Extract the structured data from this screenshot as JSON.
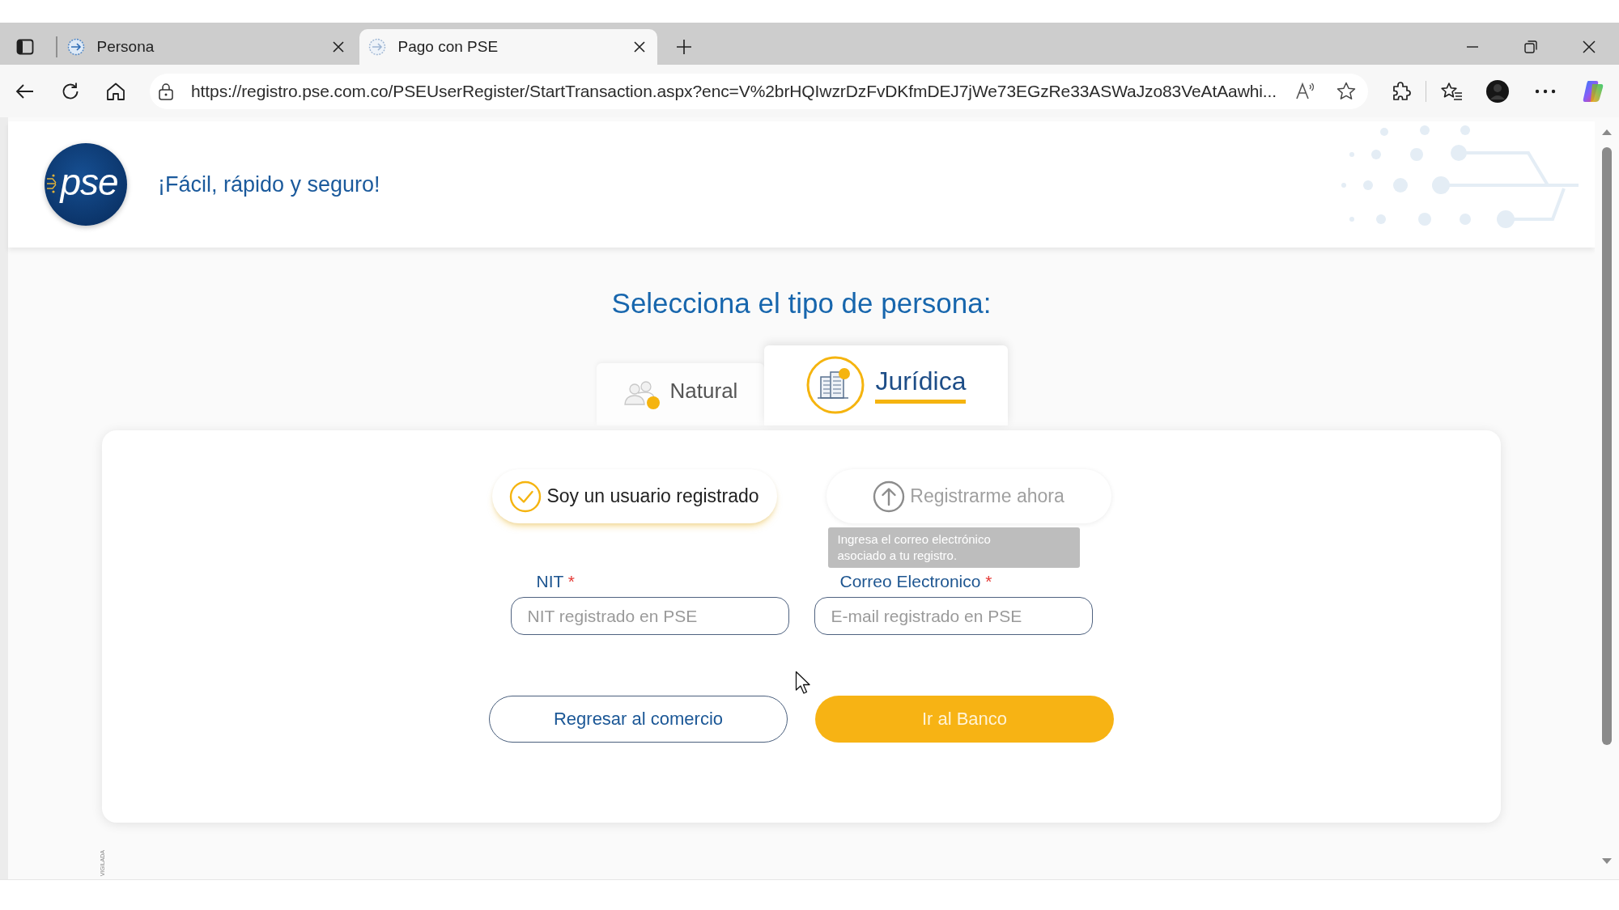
{
  "browser": {
    "tabs": [
      {
        "title": "Persona",
        "selected": false
      },
      {
        "title": "Pago con PSE",
        "selected": true
      }
    ],
    "address": "https://registro.pse.com.co/PSEUserRegister/StartTransaction.aspx?enc=V%2brHQIwzrDzFvDKfmDEJ7jWe73EGzRe33ASWaJzo83VeAtAawhi..."
  },
  "header": {
    "logo_text": "pse",
    "tagline": "¡Fácil, rápido y seguro!"
  },
  "heading": "Selecciona el tipo de persona:",
  "person_types": [
    {
      "label": "Natural",
      "kind": "natural",
      "selected": false
    },
    {
      "label": "Jurídica",
      "kind": "juridica",
      "selected": true
    }
  ],
  "user_options": [
    {
      "label": "Soy un usuario registrado",
      "kind": "login",
      "selected": true
    },
    {
      "label": "Registrarme ahora",
      "kind": "register",
      "selected": false
    }
  ],
  "fields": [
    {
      "label": "NIT",
      "required_mark": "*",
      "placeholder": "NIT registrado en PSE"
    },
    {
      "label": "Correo Electronico",
      "required_mark": "*",
      "placeholder": "E-mail registrado en PSE",
      "tooltip": "Ingresa el correo electrónico asociado a tu registro."
    }
  ],
  "buttons": [
    {
      "label": "Regresar al comercio",
      "kind": "secondary"
    },
    {
      "label": "Ir al Banco",
      "kind": "primary"
    }
  ],
  "footer_note": "VIGILADA"
}
